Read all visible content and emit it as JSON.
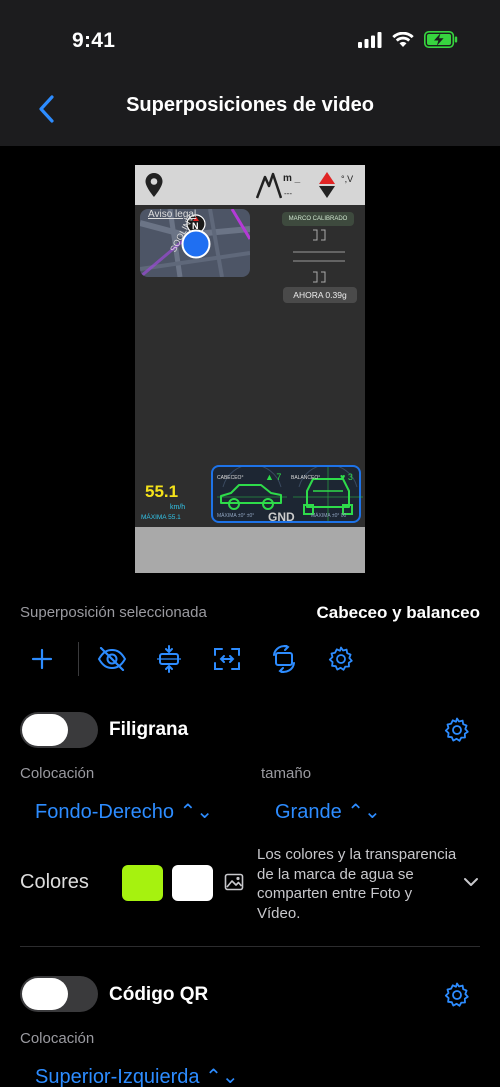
{
  "status": {
    "time": "9:41"
  },
  "nav": {
    "title": "Superposiciones de video"
  },
  "preview": {
    "top_m": "m _",
    "top_dash": "---",
    "top_v": "°,V",
    "map_label": "Aviso legal",
    "map_street": "SOOLINV",
    "compass_letter": "N",
    "calibrated": "MARCO CALIBRADO",
    "now": "AHORA 0.39g",
    "speed": "55.1",
    "speed_unit": "km/h",
    "speed_max": "MÁXIMA 55.1",
    "gnd": "GND",
    "pitch_label": "CABECEO°",
    "pitch_value": "▲ 7",
    "roll_label": "BALANCEO°",
    "roll_value": "♥ 3",
    "pitch_max": "MÁXIMA ±0° ±0°",
    "roll_max": "MÁXIMA ±0° 00"
  },
  "selected_overlay": {
    "label": "Superposición seleccionada",
    "value": "Cabeceo y balanceo"
  },
  "toolbar": {
    "icons": [
      "plus-icon",
      "eye-slash-icon",
      "vertical-align-icon",
      "resize-icon",
      "rotate-icon",
      "gear-icon"
    ]
  },
  "watermark": {
    "title": "Filigrana",
    "enabled": false,
    "placement_label": "Colocación",
    "placement_value": "Fondo-Derecho ⌃⌄",
    "size_label": "tamaño",
    "size_value": "Grande ⌃⌄",
    "colors_label": "Colores",
    "color_1": "#a6f20f",
    "color_2": "#ffffff",
    "note": "Los colores y la transparencia de la marca de agua se comparten entre Foto y Vídeo."
  },
  "qr": {
    "title": "Código QR",
    "enabled": false,
    "placement_label": "Colocación",
    "placement_value": "Superior-Izquierda ⌃⌄"
  },
  "colors": {
    "accent": "#2d8cff",
    "background": "#000000",
    "bar": "#1c1c1e",
    "battery": "#37d43f"
  }
}
